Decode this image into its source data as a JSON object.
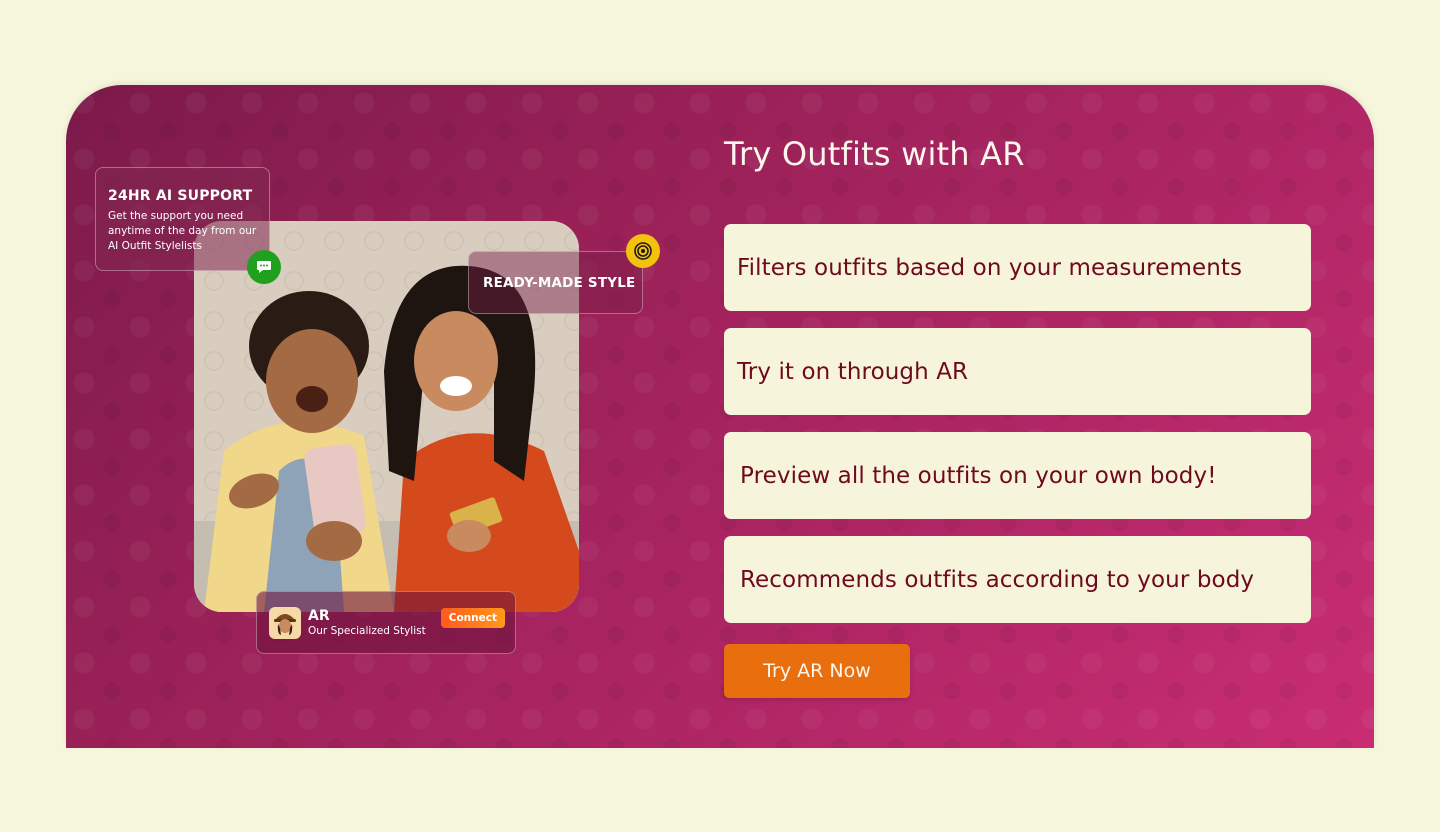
{
  "colors": {
    "page_bg": "#f6f6dc",
    "panel_gradient_start": "#7c1a4a",
    "panel_gradient_end": "#c92d74",
    "feature_card_bg": "#f7f4dc",
    "feature_text": "#6e0a1e",
    "cta_bg": "#e96f0e",
    "chat_badge": "#1fa01f",
    "target_badge": "#f4c20d"
  },
  "left": {
    "support_card": {
      "title": "24HR AI SUPPORT",
      "description": "Get the support you need anytime of the day from our AI Outfit Stylelists",
      "badge_icon": "chat-bubble-icon"
    },
    "style_card": {
      "label": "READY-MADE STYLE",
      "badge_icon": "target-icon"
    },
    "photo": {
      "icon": "couple-with-phone-photo"
    },
    "stylist_card": {
      "avatar_icon": "stylist-avatar-icon",
      "name": "AR",
      "role": "Our Specialized Stylist",
      "connect_label": "Connect"
    }
  },
  "right": {
    "heading": "Try Outfits with AR",
    "features": [
      {
        "text": "Filters outfits based on your measurements"
      },
      {
        "text": "Try it on through AR"
      },
      {
        "text": "Preview all the outfits on your own body!"
      },
      {
        "text": "Recommends outfits according to your body"
      }
    ],
    "cta_label": "Try AR Now"
  }
}
